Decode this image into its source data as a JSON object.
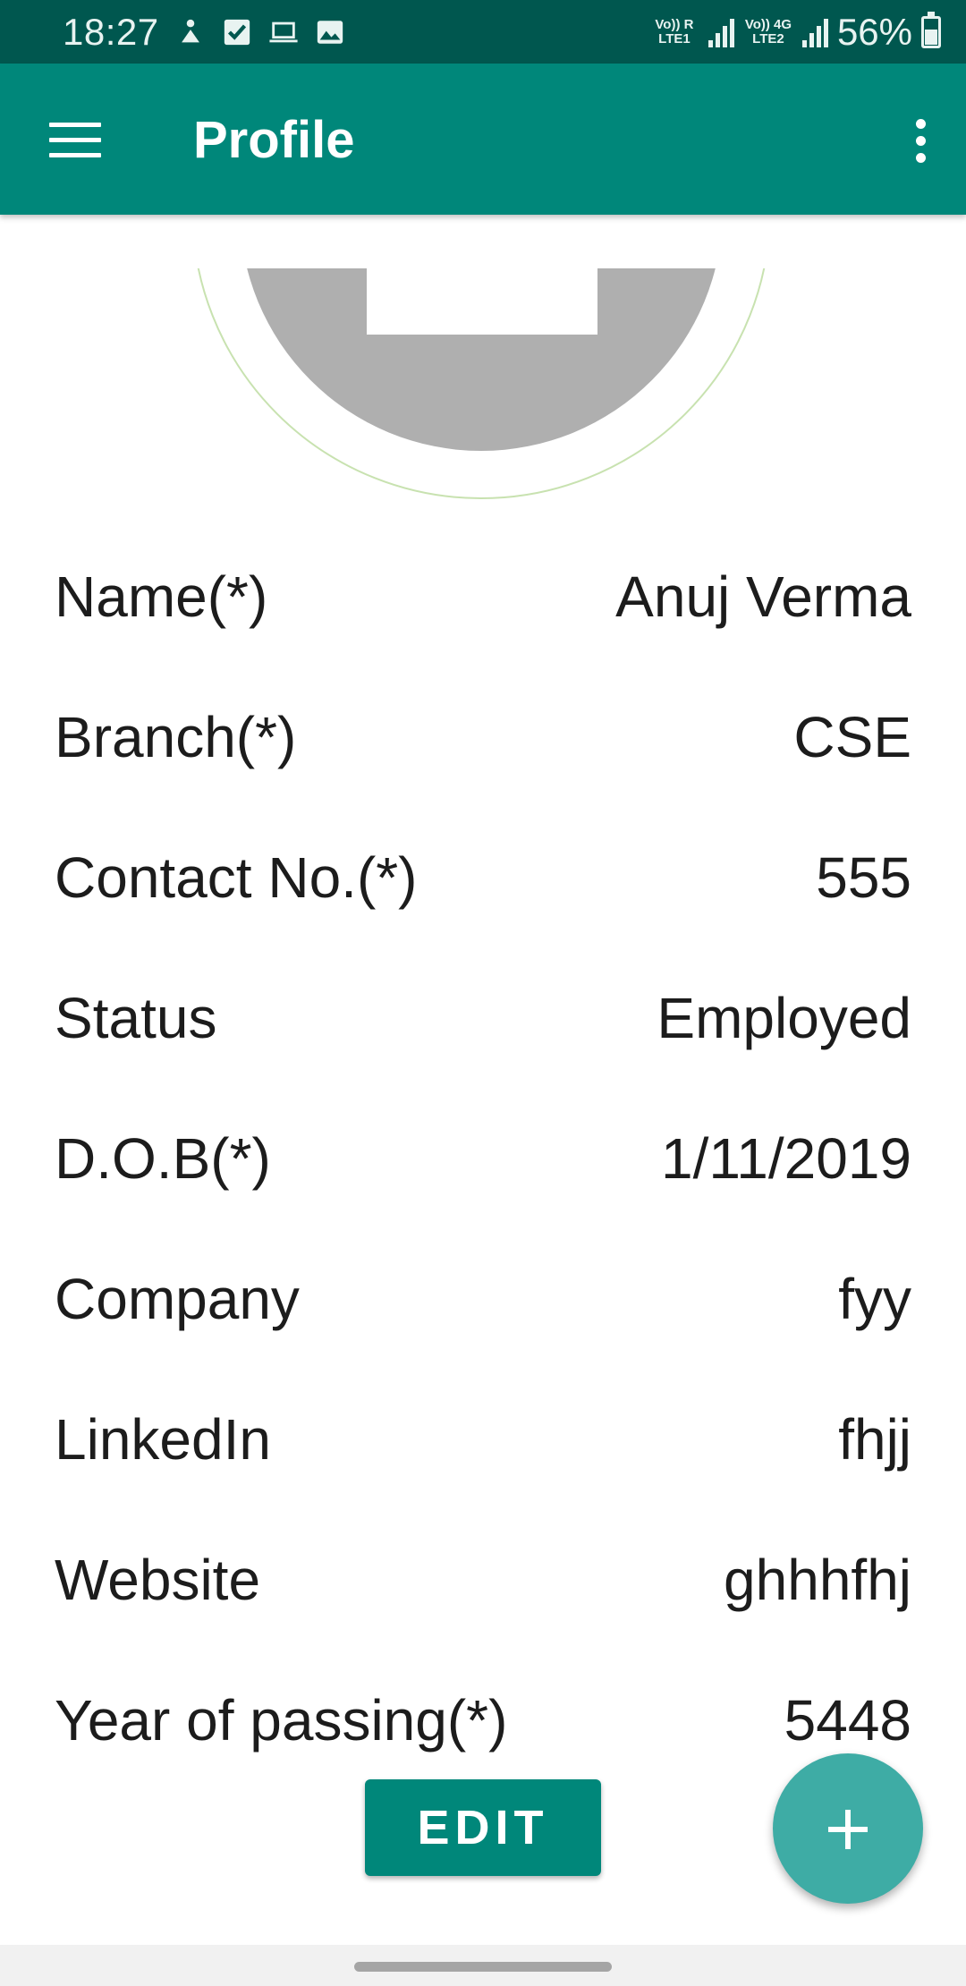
{
  "status_bar": {
    "time": "18:27",
    "icons": [
      "accessibility-icon",
      "checkbox-icon",
      "laptop-icon",
      "image-icon"
    ],
    "sim1": "Vo)) R LTE1",
    "sim2": "Vo)) 4G LTE2",
    "battery": "56%"
  },
  "app_bar": {
    "title": "Profile",
    "menu_icon": "hamburger-menu-icon",
    "overflow_icon": "more-vert-icon",
    "color": "#00877a"
  },
  "profile": {
    "fields": [
      {
        "label": "Name(*)",
        "value": "Anuj Verma"
      },
      {
        "label": "Branch(*)",
        "value": "CSE"
      },
      {
        "label": "Contact No.(*)",
        "value": "555"
      },
      {
        "label": "Status",
        "value": "Employed"
      },
      {
        "label": "D.O.B(*)",
        "value": "1/11/2019"
      },
      {
        "label": "Company",
        "value": "fyy"
      },
      {
        "label": "LinkedIn",
        "value": "fhjj"
      },
      {
        "label": "Website",
        "value": "ghhhfhj"
      },
      {
        "label": "Year of passing(*)",
        "value": "5448"
      }
    ]
  },
  "actions": {
    "edit_label": "EDIT",
    "fab_icon": "plus-icon",
    "fab_color": "#3eaca5"
  }
}
